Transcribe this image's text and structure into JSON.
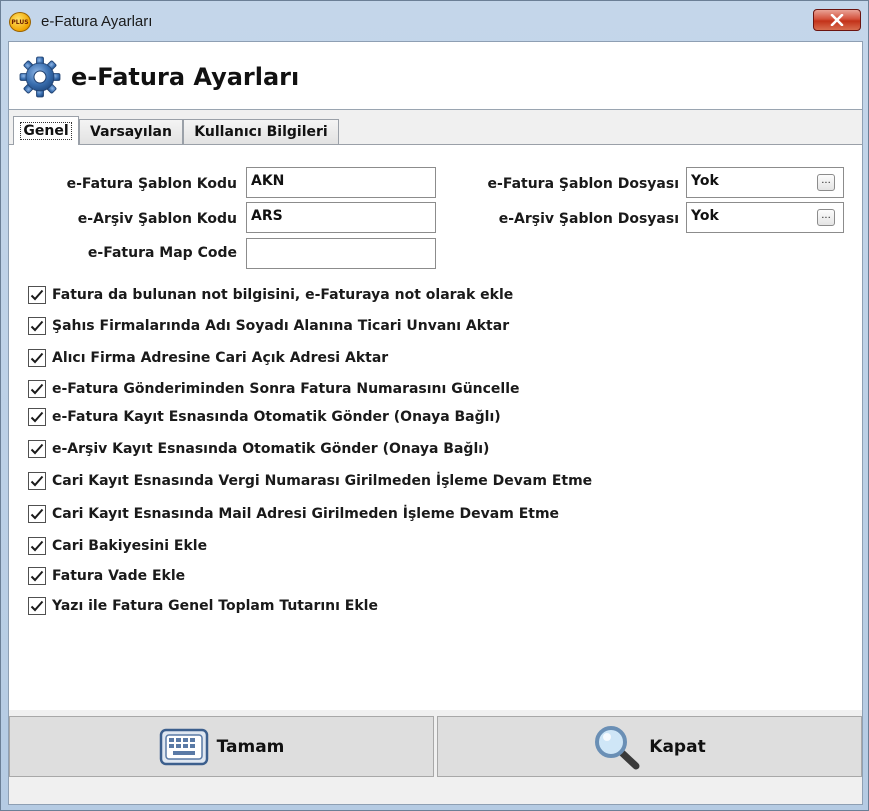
{
  "window": {
    "title": "e-Fatura Ayarları",
    "app_icon_text": "PLUS"
  },
  "header": {
    "title": "e-Fatura Ayarları"
  },
  "tabs": [
    {
      "label": "Genel",
      "active": true
    },
    {
      "label": "Varsayılan",
      "active": false
    },
    {
      "label": "Kullanıcı Bilgileri",
      "active": false
    }
  ],
  "form": {
    "efatura_template_code": {
      "label": "e-Fatura Şablon Kodu",
      "value": "AKN"
    },
    "earsiv_template_code": {
      "label": "e-Arşiv Şablon Kodu",
      "value": "ARS"
    },
    "efatura_map_code": {
      "label": "e-Fatura Map Code",
      "value": ""
    },
    "efatura_template_file": {
      "label": "e-Fatura Şablon Dosyası",
      "value": "Yok",
      "button": "..."
    },
    "earsiv_template_file": {
      "label": "e-Arşiv Şablon Dosyası",
      "value": "Yok",
      "button": "..."
    }
  },
  "options": [
    {
      "label": "Fatura da bulunan not bilgisini, e-Faturaya not olarak ekle",
      "checked": true
    },
    {
      "label": "Şahıs Firmalarında Adı Soyadı Alanına Ticari Unvanı Aktar",
      "checked": true
    },
    {
      "label": "Alıcı Firma Adresine Cari Açık Adresi Aktar",
      "checked": true
    },
    {
      "label": "e-Fatura Gönderiminden Sonra Fatura Numarasını Güncelle",
      "checked": true
    },
    {
      "label": "e-Fatura Kayıt Esnasında Otomatik Gönder (Onaya Bağlı)",
      "checked": true
    },
    {
      "label": "e-Arşiv Kayıt Esnasında Otomatik Gönder (Onaya Bağlı)",
      "checked": true
    },
    {
      "label": "Cari Kayıt Esnasında Vergi Numarası Girilmeden İşleme Devam Etme",
      "checked": true
    },
    {
      "label": "Cari Kayıt Esnasında Mail Adresi Girilmeden İşleme Devam Etme",
      "checked": true
    },
    {
      "label": "Cari Bakiyesini Ekle",
      "checked": true
    },
    {
      "label": "Fatura Vade Ekle",
      "checked": true
    },
    {
      "label": "Yazı ile Fatura Genel Toplam Tutarını Ekle",
      "checked": true
    }
  ],
  "buttons": {
    "ok": {
      "label": "Tamam",
      "icon": "keyboard-icon"
    },
    "close": {
      "label": "Kapat",
      "icon": "magnifier-icon"
    }
  },
  "colors": {
    "title_bar": "#c4d6ea",
    "close_button": "#c33219",
    "gear_blue": "#3a6fb0"
  }
}
